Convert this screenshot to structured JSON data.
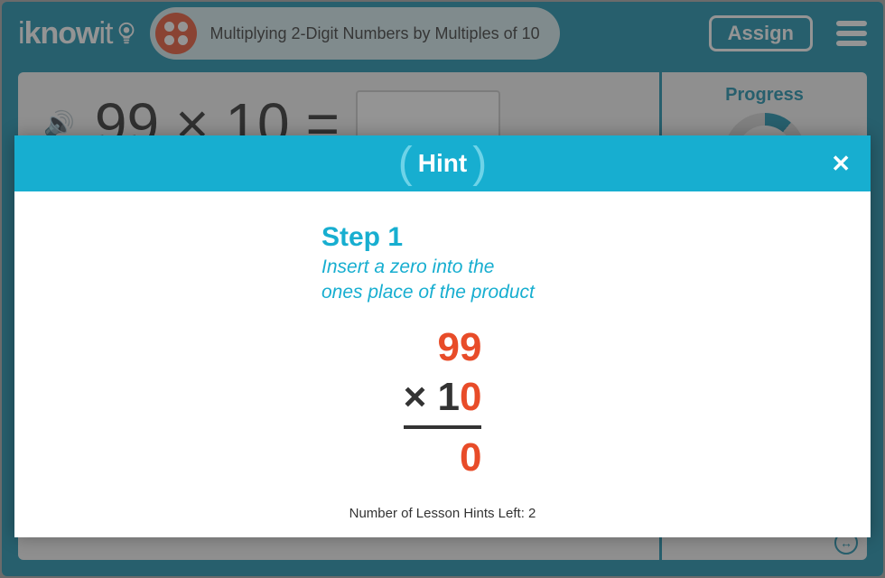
{
  "header": {
    "logo_prefix": "i",
    "logo_bold": "know",
    "logo_suffix": "it",
    "lesson_title": "Multiplying 2-Digit Numbers by Multiples of 10",
    "assign_label": "Assign"
  },
  "question": {
    "operand1": "99",
    "operator": "×",
    "operand2": "10",
    "equals": "="
  },
  "sidebar": {
    "progress_label": "Progress"
  },
  "hint": {
    "title": "Hint",
    "step_label": "Step 1",
    "step_desc_line1": "Insert a zero into the",
    "step_desc_line2": "ones place of the product",
    "math_top": "99",
    "math_mid_prefix": "× 1",
    "math_mid_orange": "0",
    "math_result": "0",
    "hints_left": "Number of Lesson Hints Left: 2"
  }
}
